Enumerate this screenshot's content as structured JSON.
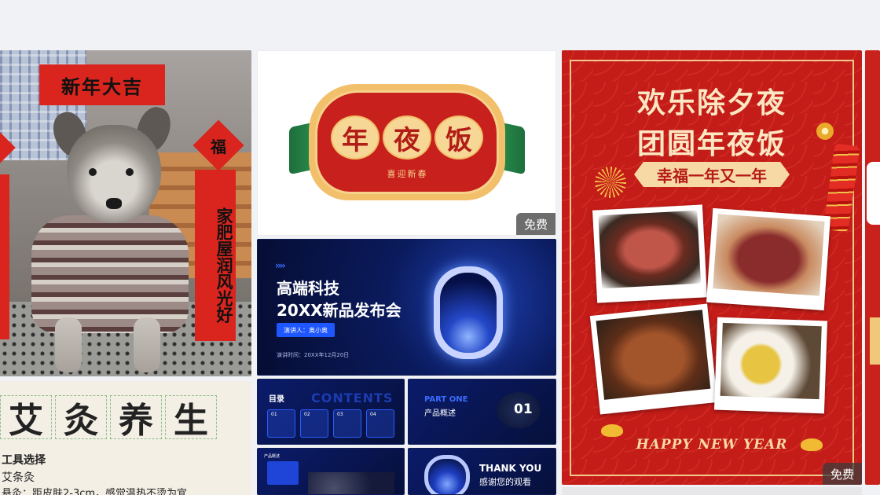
{
  "dog_card": {
    "sign_top": "新年大吉",
    "sign_diamond": "福",
    "couplet": "家肥屋润风光好"
  },
  "moxa_card": {
    "title_chars": [
      "艾",
      "灸",
      "养",
      "生"
    ],
    "line1": "工具选择",
    "line2": "艾条灸",
    "line3": "悬灸：距皮肤2-3cm，感觉温热不烫为宜"
  },
  "nyf_card": {
    "chars": [
      "年",
      "夜",
      "饭"
    ],
    "subtitle": "喜迎新春",
    "badge": "免费"
  },
  "tech_card": {
    "title1": "高端科技",
    "title2": "20XX新品发布会",
    "speaker": "演讲人：奥小奥",
    "date": "演讲时间：20XX年12月20日",
    "arrows": "››››"
  },
  "ppt_a": {
    "title": "目录",
    "contents": "CONTENTS",
    "items": [
      "01",
      "02",
      "03",
      "04"
    ]
  },
  "ppt_b": {
    "part": "PART ONE",
    "name": "产品概述",
    "num": "01"
  },
  "ppt_c": {
    "title": "产品概述"
  },
  "ppt_d": {
    "line1": "THANK YOU",
    "line2": "感谢您的观看"
  },
  "poster_card": {
    "title1": "欢乐除夕夜",
    "title2": "团圆年夜饭",
    "ribbon": "幸福一年又一年",
    "footer": "HAPPY NEW YEAR",
    "badge": "免费"
  },
  "colors": {
    "festive_red": "#c41c18",
    "gold": "#f2c98a",
    "tech_blue": "#1e56ff",
    "page_bg": "#f1f2f5"
  }
}
